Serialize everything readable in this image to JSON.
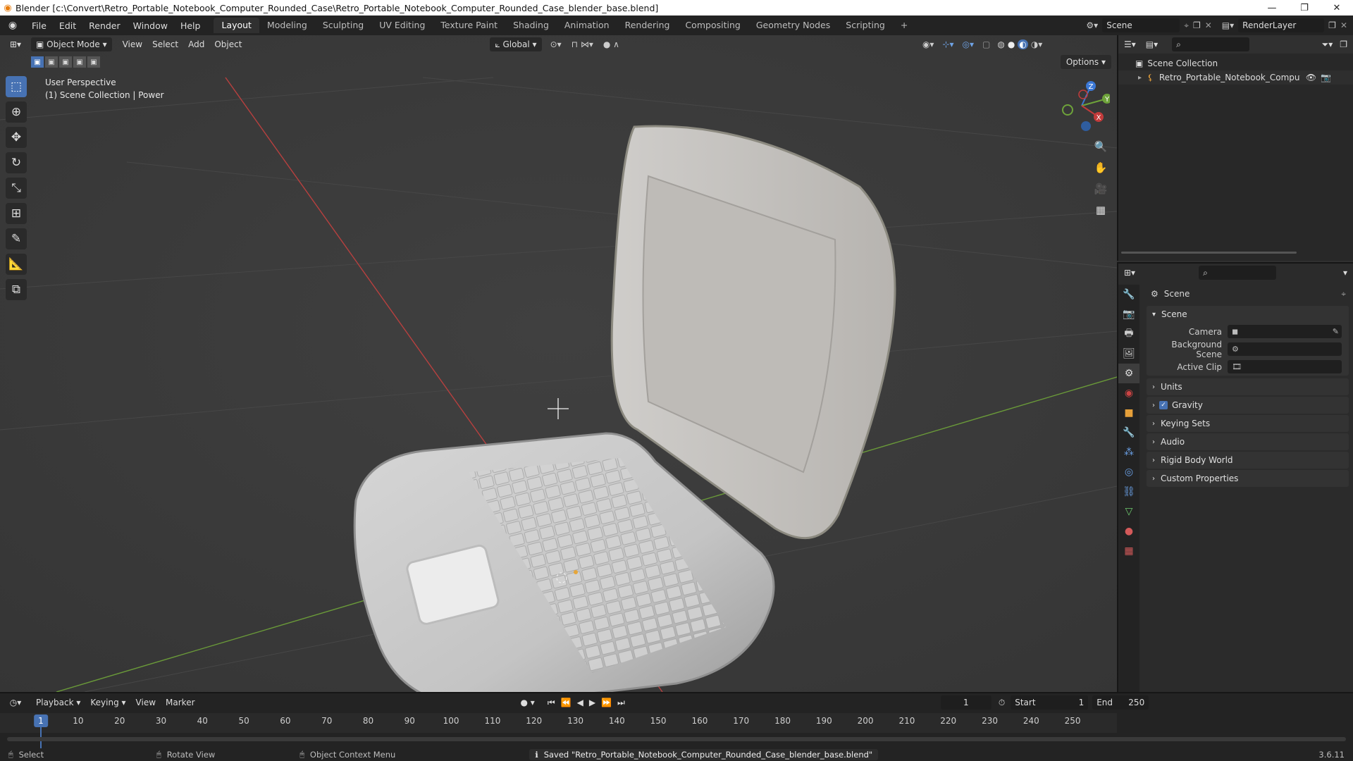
{
  "window": {
    "title": "Blender [c:\\Convert\\Retro_Portable_Notebook_Computer_Rounded_Case\\Retro_Portable_Notebook_Computer_Rounded_Case_blender_base.blend]",
    "minimize": "—",
    "maximize": "❐",
    "close": "✕"
  },
  "menu": [
    "File",
    "Edit",
    "Render",
    "Window",
    "Help"
  ],
  "workspaces": [
    "Layout",
    "Modeling",
    "Sculpting",
    "UV Editing",
    "Texture Paint",
    "Shading",
    "Animation",
    "Rendering",
    "Compositing",
    "Geometry Nodes",
    "Scripting",
    "+"
  ],
  "active_workspace": "Layout",
  "scene_selector": {
    "label": "Scene",
    "view_layer": "RenderLayer"
  },
  "viewport": {
    "mode": "Object Mode",
    "menus": [
      "View",
      "Select",
      "Add",
      "Object"
    ],
    "orientation": "Global",
    "options": "Options",
    "info_line1": "User Perspective",
    "info_line2": "(1) Scene Collection | Power",
    "gizmo": {
      "z": "Z",
      "y": "Y",
      "x": "X"
    }
  },
  "outliner": {
    "root": "Scene Collection",
    "items": [
      "Retro_Portable_Notebook_Computer_Rc"
    ]
  },
  "properties": {
    "header": "Scene",
    "panel_scene": "Scene",
    "rows": [
      {
        "label": "Camera"
      },
      {
        "label": "Background Scene"
      },
      {
        "label": "Active Clip"
      }
    ],
    "collapsed": [
      "Units",
      "Gravity",
      "Keying Sets",
      "Audio",
      "Rigid Body World",
      "Custom Properties"
    ],
    "gravity_checked": true
  },
  "timeline": {
    "menus": [
      "Playback",
      "Keying",
      "View",
      "Marker"
    ],
    "current_frame": "1",
    "start_label": "Start",
    "start": "1",
    "end_label": "End",
    "end": "250",
    "ticks": [
      "1",
      "10",
      "20",
      "30",
      "40",
      "50",
      "60",
      "70",
      "80",
      "90",
      "100",
      "110",
      "120",
      "130",
      "140",
      "150",
      "160",
      "170",
      "180",
      "190",
      "200",
      "210",
      "220",
      "230",
      "240",
      "250"
    ]
  },
  "status": {
    "select": "Select",
    "rotate": "Rotate View",
    "context": "Object Context Menu",
    "saved": "Saved \"Retro_Portable_Notebook_Computer_Rounded_Case_blender_base.blend\"",
    "version": "3.6.11"
  },
  "colors": {
    "accent": "#4772b3",
    "x_axis": "#c23b3b",
    "y_axis": "#6ea33a",
    "z_axis": "#3b78d6"
  }
}
